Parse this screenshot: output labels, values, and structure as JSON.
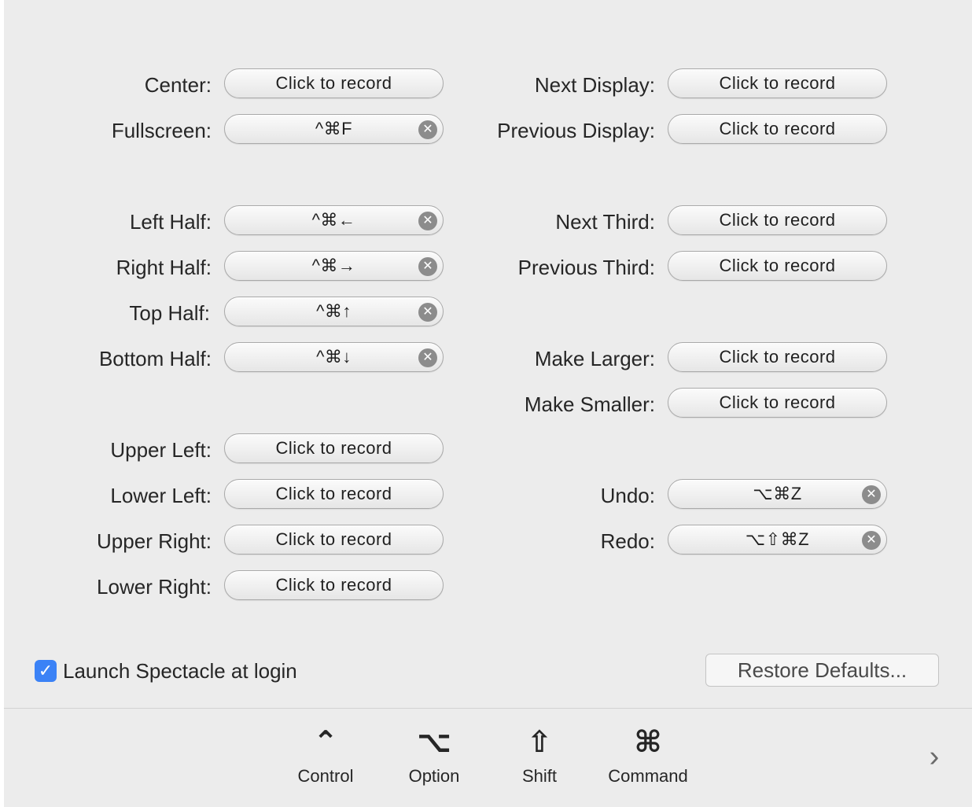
{
  "left_column": [
    {
      "label": "Center:",
      "value": "Click to record",
      "recorded": false
    },
    {
      "label": "Fullscreen:",
      "value": "^⌘F",
      "recorded": true
    },
    {
      "label": "Left Half:",
      "value": "^⌘←",
      "recorded": true
    },
    {
      "label": "Right Half:",
      "value": "^⌘→",
      "recorded": true
    },
    {
      "label": "Top Half:",
      "value": "^⌘↑",
      "recorded": true
    },
    {
      "label": "Bottom Half:",
      "value": "^⌘↓",
      "recorded": true
    },
    {
      "label": "Upper Left:",
      "value": "Click to record",
      "recorded": false
    },
    {
      "label": "Lower Left:",
      "value": "Click to record",
      "recorded": false
    },
    {
      "label": "Upper Right:",
      "value": "Click to record",
      "recorded": false
    },
    {
      "label": "Lower Right:",
      "value": "Click to record",
      "recorded": false
    }
  ],
  "right_column": [
    {
      "label": "Next Display:",
      "value": "Click to record",
      "recorded": false
    },
    {
      "label": "Previous Display:",
      "value": "Click to record",
      "recorded": false
    },
    {
      "label": "Next Third:",
      "value": "Click to record",
      "recorded": false
    },
    {
      "label": "Previous Third:",
      "value": "Click to record",
      "recorded": false
    },
    {
      "label": "Make Larger:",
      "value": "Click to record",
      "recorded": false
    },
    {
      "label": "Make Smaller:",
      "value": "Click to record",
      "recorded": false
    },
    {
      "label": "Undo:",
      "value": "⌥⌘Z",
      "recorded": true
    },
    {
      "label": "Redo:",
      "value": "⌥⇧⌘Z",
      "recorded": true
    }
  ],
  "launch_at_login": {
    "label": "Launch Spectacle at login",
    "checked": true
  },
  "restore_defaults": {
    "label": "Restore Defaults..."
  },
  "modifiers": [
    {
      "glyph": "⌃",
      "label": "Control",
      "icon": "control-key-icon"
    },
    {
      "glyph": "⌥",
      "label": "Option",
      "icon": "option-key-icon"
    },
    {
      "glyph": "⇧",
      "label": "Shift",
      "icon": "shift-key-icon"
    },
    {
      "glyph": "⌘",
      "label": "Command",
      "icon": "command-key-icon"
    }
  ],
  "clear_glyph": "✕",
  "check_glyph": "✓",
  "next_glyph": "›",
  "colors": {
    "accent": "#3b82f6",
    "window": "#ececec"
  }
}
